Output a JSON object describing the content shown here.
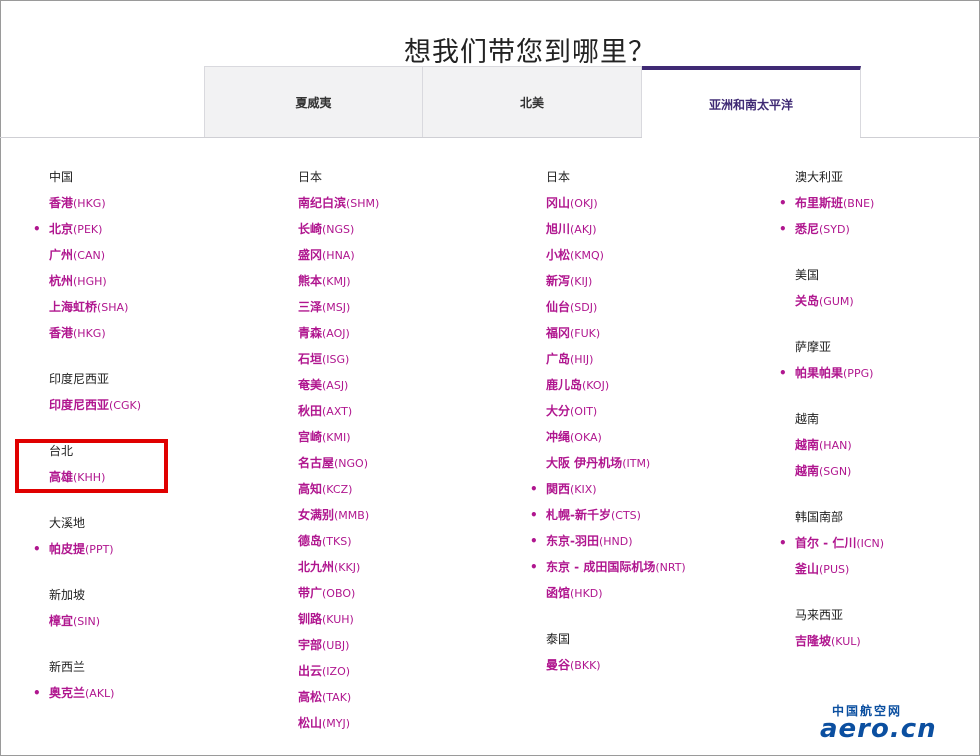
{
  "page_title": "想我们带您到哪里？",
  "tabs": [
    {
      "label": "夏威夷",
      "active": false
    },
    {
      "label": "北美",
      "active": false
    },
    {
      "label": "亚洲和南太平洋",
      "active": true
    }
  ],
  "columns": [
    {
      "groups": [
        {
          "title": "中国",
          "cities": [
            {
              "name": "香港",
              "code": "(HKG)",
              "dot": false
            },
            {
              "name": "北京",
              "code": "(PEK)",
              "dot": true
            },
            {
              "name": "广州",
              "code": "(CAN)",
              "dot": false
            },
            {
              "name": "杭州",
              "code": "(HGH)",
              "dot": false
            },
            {
              "name": "上海虹桥",
              "code": "(SHA)",
              "dot": false
            },
            {
              "name": "香港",
              "code": "(HKG)",
              "dot": false
            }
          ]
        },
        {
          "title": "印度尼西亚",
          "cities": [
            {
              "name": "印度尼西亚",
              "code": "(CGK)",
              "dot": false
            }
          ]
        },
        {
          "title": "台北",
          "cities": [
            {
              "name": "高雄",
              "code": "(KHH)",
              "dot": false
            }
          ]
        },
        {
          "title": "大溪地",
          "cities": [
            {
              "name": "帕皮提",
              "code": "(PPT)",
              "dot": true
            }
          ]
        },
        {
          "title": "新加坡",
          "cities": [
            {
              "name": "樟宜",
              "code": "(SIN)",
              "dot": false
            }
          ]
        },
        {
          "title": "新西兰",
          "cities": [
            {
              "name": "奥克兰",
              "code": "(AKL)",
              "dot": true
            }
          ]
        }
      ]
    },
    {
      "groups": [
        {
          "title": "日本",
          "cities": [
            {
              "name": "南纪白滨",
              "code": "(SHM)",
              "dot": false
            },
            {
              "name": "长崎",
              "code": "(NGS)",
              "dot": false
            },
            {
              "name": "盛冈",
              "code": "(HNA)",
              "dot": false
            },
            {
              "name": "熊本",
              "code": "(KMJ)",
              "dot": false
            },
            {
              "name": "三泽",
              "code": "(MSJ)",
              "dot": false
            },
            {
              "name": "青森",
              "code": "(AOJ)",
              "dot": false
            },
            {
              "name": "石垣",
              "code": "(ISG)",
              "dot": false
            },
            {
              "name": "奄美",
              "code": "(ASJ)",
              "dot": false
            },
            {
              "name": "秋田",
              "code": "(AXT)",
              "dot": false
            },
            {
              "name": "宫崎",
              "code": "(KMI)",
              "dot": false
            },
            {
              "name": "名古屋",
              "code": "(NGO)",
              "dot": false
            },
            {
              "name": "高知",
              "code": "(KCZ)",
              "dot": false
            },
            {
              "name": "女满别",
              "code": "(MMB)",
              "dot": false
            },
            {
              "name": "德岛",
              "code": "(TKS)",
              "dot": false
            },
            {
              "name": "北九州",
              "code": "(KKJ)",
              "dot": false
            },
            {
              "name": "带广",
              "code": "(OBO)",
              "dot": false
            },
            {
              "name": "钏路",
              "code": "(KUH)",
              "dot": false
            },
            {
              "name": "宇部",
              "code": "(UBJ)",
              "dot": false
            },
            {
              "name": "出云",
              "code": "(IZO)",
              "dot": false
            },
            {
              "name": "高松",
              "code": "(TAK)",
              "dot": false
            },
            {
              "name": "松山",
              "code": "(MYJ)",
              "dot": false
            }
          ]
        }
      ]
    },
    {
      "groups": [
        {
          "title": "日本",
          "cities": [
            {
              "name": "冈山",
              "code": "(OKJ)",
              "dot": false
            },
            {
              "name": "旭川",
              "code": "(AKJ)",
              "dot": false
            },
            {
              "name": "小松",
              "code": "(KMQ)",
              "dot": false
            },
            {
              "name": "新泻",
              "code": "(KIJ)",
              "dot": false
            },
            {
              "name": "仙台",
              "code": "(SDJ)",
              "dot": false
            },
            {
              "name": "福冈",
              "code": "(FUK)",
              "dot": false
            },
            {
              "name": "广岛",
              "code": "(HIJ)",
              "dot": false
            },
            {
              "name": "鹿儿岛",
              "code": "(KOJ)",
              "dot": false
            },
            {
              "name": "大分",
              "code": "(OIT)",
              "dot": false
            },
            {
              "name": "冲绳",
              "code": "(OKA)",
              "dot": false
            },
            {
              "name": "大阪 伊丹机场",
              "code": "(ITM)",
              "dot": false
            },
            {
              "name": "関西",
              "code": "(KIX)",
              "dot": true
            },
            {
              "name": "札幌-新千岁",
              "code": "(CTS)",
              "dot": true
            },
            {
              "name": "东京-羽田",
              "code": "(HND)",
              "dot": true
            },
            {
              "name": "东京 - 成田国际机场",
              "code": "(NRT)",
              "dot": true
            },
            {
              "name": "函馆",
              "code": "(HKD)",
              "dot": false
            }
          ]
        },
        {
          "title": "泰国",
          "cities": [
            {
              "name": "曼谷",
              "code": "(BKK)",
              "dot": false
            }
          ]
        }
      ]
    },
    {
      "groups": [
        {
          "title": "澳大利亚",
          "cities": [
            {
              "name": "布里斯班",
              "code": "(BNE)",
              "dot": true
            },
            {
              "name": "悉尼",
              "code": "(SYD)",
              "dot": true
            }
          ]
        },
        {
          "title": "美国",
          "cities": [
            {
              "name": "关岛",
              "code": "(GUM)",
              "dot": false
            }
          ]
        },
        {
          "title": "萨摩亚",
          "cities": [
            {
              "name": "帕果帕果",
              "code": "(PPG)",
              "dot": true
            }
          ]
        },
        {
          "title": "越南",
          "cities": [
            {
              "name": "越南",
              "code": "(HAN)",
              "dot": false
            },
            {
              "name": "越南",
              "code": "(SGN)",
              "dot": false
            }
          ]
        },
        {
          "title": "韩国南部",
          "cities": [
            {
              "name": "首尔 - 仁川",
              "code": "(ICN)",
              "dot": true
            },
            {
              "name": "釜山",
              "code": "(PUS)",
              "dot": false
            }
          ]
        },
        {
          "title": "马来西亚",
          "cities": [
            {
              "name": "吉隆坡",
              "code": "(KUL)",
              "dot": false
            }
          ]
        }
      ]
    }
  ],
  "watermark": {
    "top": "中国航空网",
    "main": "aero.cn"
  },
  "colors": {
    "accent": "#3f2a74",
    "link": "#b0168f",
    "highlight": "#e00000"
  }
}
